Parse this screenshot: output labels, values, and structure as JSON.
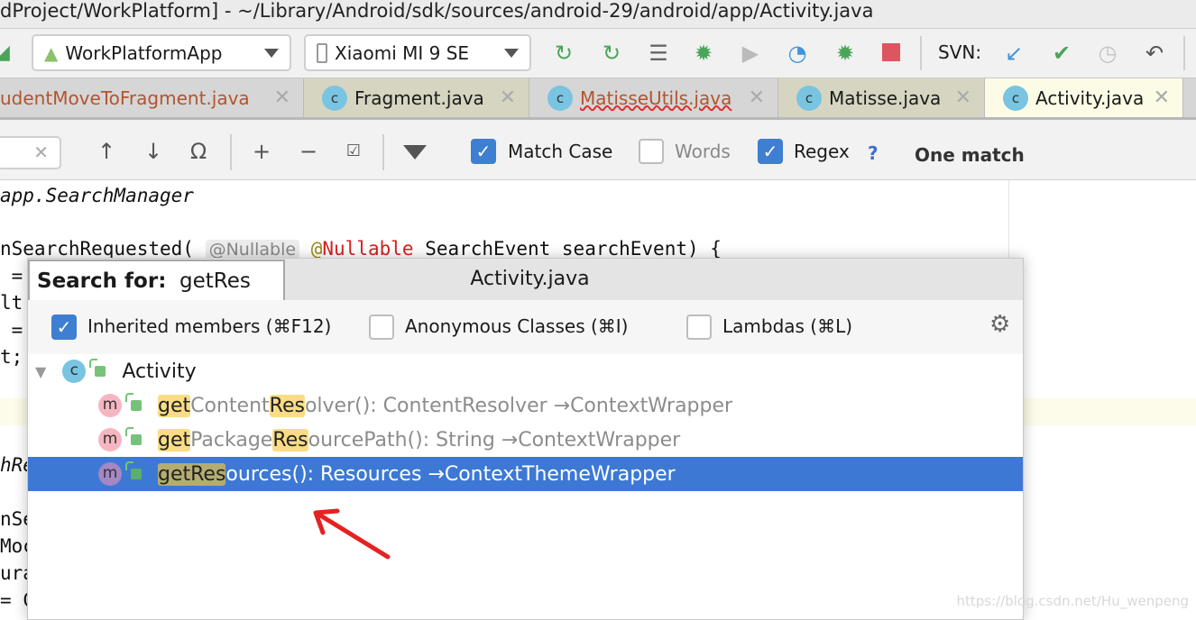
{
  "window": {
    "title": "dProject/WorkPlatform] - ~/Library/Android/sdk/sources/android-29/android/app/Activity.java"
  },
  "toolbar": {
    "run_config": "WorkPlatformApp",
    "device": "Xiaomi MI 9 SE",
    "icons": [
      "apply-changes-icon",
      "apply-code-changes-icon",
      "logcat-icon",
      "debug-icon",
      "coverage-icon",
      "profile-icon",
      "attach-debugger-icon",
      "stop-icon"
    ],
    "svn_label": "SVN:",
    "svn_icons": [
      "svn-update-icon",
      "svn-commit-icon",
      "history-icon",
      "revert-icon"
    ],
    "colors": {
      "stop": "#dc5660",
      "run": "#4aa55a",
      "svn_update": "#3f95dc"
    }
  },
  "tabs": [
    {
      "label": "udentMoveToFragment.java",
      "color": "#b3542e",
      "active": false
    },
    {
      "label": "Fragment.java",
      "active": false
    },
    {
      "label": "MatisseUtils.java",
      "color": "#b3542e",
      "error": true,
      "active": false
    },
    {
      "label": "Matisse.java",
      "active": false
    },
    {
      "label": "Activity.java",
      "active": true
    }
  ],
  "findbar": {
    "match_case": {
      "label": "Match Case",
      "checked": true
    },
    "words": {
      "label": "Words",
      "checked": false
    },
    "regex": {
      "label": "Regex",
      "checked": true
    },
    "help": "?",
    "result": "One match"
  },
  "code": {
    "lines": [
      "app.SearchManager",
      "nSearchRequested(",
      "@Nullable",
      "@",
      "Nullable",
      " SearchEvent searchEvent) {",
      " =",
      "lt",
      " =",
      "t;",
      "hRe",
      "nSe",
      "Moc",
      "ura",
      "= C"
    ]
  },
  "popup": {
    "search_label": "Search for:",
    "search_value": "getRes",
    "title": "Activity.java",
    "options": [
      {
        "label": "Inherited members (⌘F12)",
        "checked": true
      },
      {
        "label": "Anonymous Classes (⌘I)",
        "checked": false
      },
      {
        "label": "Lambdas (⌘L)",
        "checked": false
      }
    ],
    "root": "Activity",
    "root_icon": "c",
    "items": [
      {
        "icon": "m",
        "parts": [
          "get",
          "Content",
          "Res",
          "olver(): ContentResolver →ContextWrapper"
        ],
        "selected": false
      },
      {
        "icon": "m",
        "parts": [
          "get",
          "Package",
          "Res",
          "ourcePath(): String →ContextWrapper"
        ],
        "selected": false
      },
      {
        "icon": "m",
        "parts": [
          "getRes",
          "ources(): Resources →ContextThemeWrapper"
        ],
        "selected": true
      }
    ],
    "selected_color": "#3d78d4"
  },
  "watermark": "https://blog.csdn.net/Hu_wenpeng"
}
